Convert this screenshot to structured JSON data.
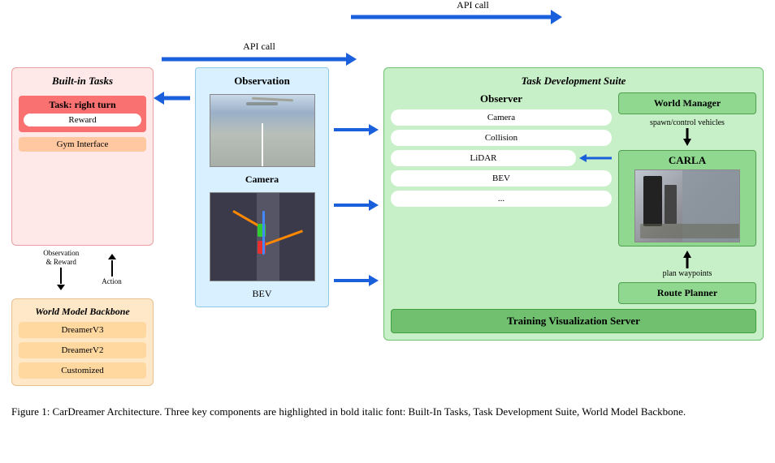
{
  "diagram": {
    "api_call_label": "API call",
    "builtin_tasks": {
      "title": "Built-in Tasks",
      "task_label": "Task: right turn",
      "reward_label": "Reward",
      "gym_interface_label": "Gym Interface"
    },
    "world_model": {
      "title": "World Model Backbone",
      "items": [
        "DreamerV3",
        "DreamerV2",
        "Customized"
      ]
    },
    "observation_section": {
      "obs_label": "Observation",
      "camera_label": "Camera",
      "bev_label": "BEV"
    },
    "observation_reward_label": "Observation\n& Reward",
    "action_label": "Action",
    "task_dev_suite": {
      "title": "Task Development Suite",
      "observer": {
        "title": "Observer",
        "items": [
          "Camera",
          "Collision",
          "LiDAR",
          "BEV",
          "..."
        ]
      },
      "world_manager": {
        "title": "World Manager",
        "spawn_label": "spawn/control vehicles"
      },
      "carla_label": "CARLA",
      "plan_label": "plan waypoints",
      "route_planner_label": "Route Planner",
      "training_vis_label": "Training Visualization Server"
    }
  },
  "caption": "Figure 1: CarDreamer Architecture. Three key components are highlighted in bold italic font: Built-In Tasks, Task Development Suite, World Model Backbone."
}
